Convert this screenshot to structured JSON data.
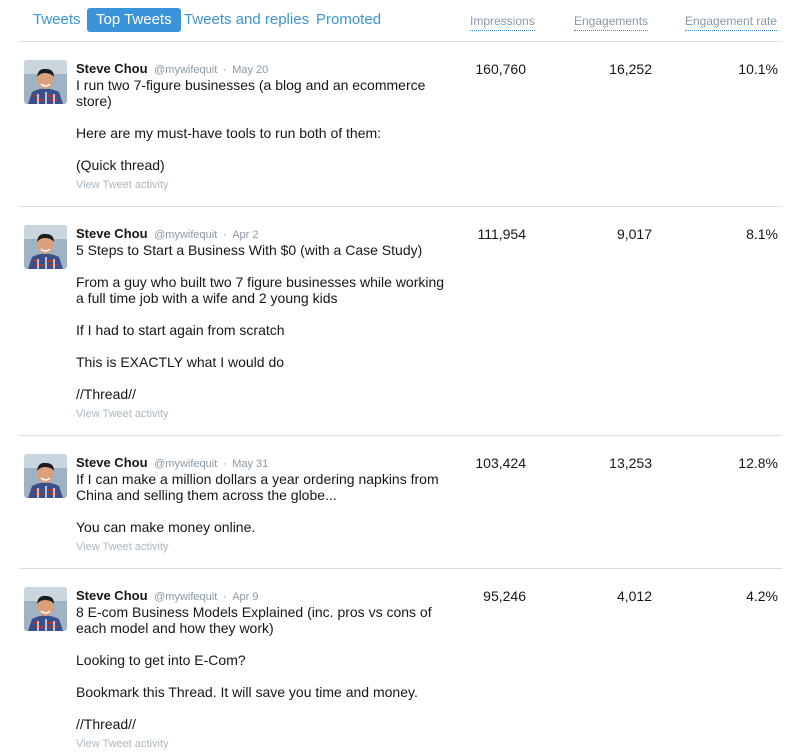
{
  "tabs": [
    {
      "label": "Tweets",
      "active": false
    },
    {
      "label": "Top Tweets",
      "active": true
    },
    {
      "label": "Tweets and replies",
      "active": false
    },
    {
      "label": "Promoted",
      "active": false
    }
  ],
  "columns": {
    "impressions": "Impressions",
    "engagements": "Engagements",
    "engagement_rate": "Engagement rate"
  },
  "colors": {
    "accent": "#3b94d9",
    "muted": "#8899a6",
    "divider": "#d8dde2"
  },
  "tweets": [
    {
      "name": "Steve Chou",
      "handle": "@mywifequit",
      "separator": "·",
      "date": "May 20",
      "text_lines": [
        "I run two 7-figure businesses (a blog and an ecommerce",
        "store)",
        "",
        "Here are my must-have tools to run both of them:",
        "",
        "(Quick thread)"
      ],
      "activity_link": "View Tweet activity",
      "impressions": "160,760",
      "engagements": "16,252",
      "engagement_rate": "10.1%"
    },
    {
      "name": "Steve Chou",
      "handle": "@mywifequit",
      "separator": "·",
      "date": "Apr 2",
      "text_lines": [
        "5 Steps to Start a Business With $0 (with a Case Study)",
        "",
        "From a guy who built two 7 figure businesses while working",
        "a full time job with a wife and 2 young kids",
        "",
        "If I had to start again from scratch",
        "",
        "This is EXACTLY what I would do",
        "",
        "//Thread//"
      ],
      "activity_link": "View Tweet activity",
      "impressions": "111,954",
      "engagements": "9,017",
      "engagement_rate": "8.1%"
    },
    {
      "name": "Steve Chou",
      "handle": "@mywifequit",
      "separator": "·",
      "date": "May 31",
      "text_lines": [
        "If I can make a million dollars a year ordering napkins from",
        "China and selling them across the globe...",
        "",
        "You can make money online."
      ],
      "activity_link": "View Tweet activity",
      "impressions": "103,424",
      "engagements": "13,253",
      "engagement_rate": "12.8%"
    },
    {
      "name": "Steve Chou",
      "handle": "@mywifequit",
      "separator": "·",
      "date": "Apr 9",
      "text_lines": [
        "8 E-com Business Models Explained (inc. pros vs cons of",
        "each model and how they work)",
        "",
        "Looking to get into E-Com?",
        "",
        "Bookmark this Thread. It will save you time and money.",
        "",
        "//Thread//"
      ],
      "activity_link": "View Tweet activity",
      "impressions": "95,246",
      "engagements": "4,012",
      "engagement_rate": "4.2%"
    }
  ]
}
